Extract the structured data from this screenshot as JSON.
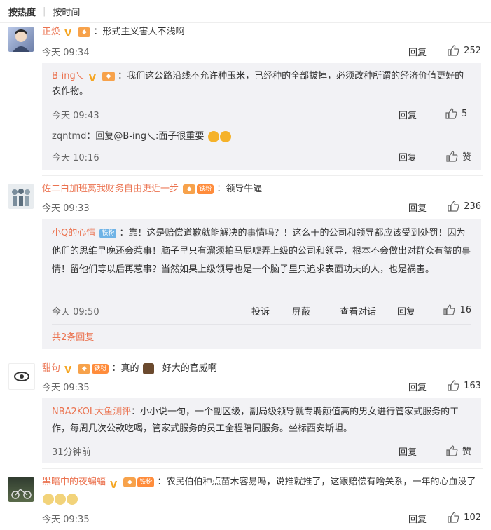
{
  "sort": {
    "hot": "按热度",
    "time": "按时间"
  },
  "labels": {
    "reply": "回复",
    "complain": "投诉",
    "block": "屏蔽",
    "view_dialog": "查看对话",
    "praise": "赞"
  },
  "comments": [
    {
      "user": "正焕",
      "text": "：形式主义害人不浅啊",
      "time": "今天 09:34",
      "likes": "252",
      "replies": [
        {
          "user": "B-ing乀",
          "text": "：我们这公路沿线不允许种玉米，已经种的全部拔掉，必须改种所谓的经济价值更好的农作物。",
          "time": "今天 09:43",
          "likes": "5"
        },
        {
          "user": "zqntmd",
          "text": "：回复@B-ing乀:面子很重要",
          "time": "今天 10:16",
          "likes": "赞"
        }
      ]
    },
    {
      "user": "佐二白加班离我财务自由更近一步",
      "fan": "铁粉",
      "text": "：领导牛逼",
      "time": "今天 09:33",
      "likes": "236",
      "replies": [
        {
          "user": "小Q的心情",
          "fan": "铁粉",
          "text": "：靠！这是赔偿道歉就能解决的事情吗？！这么干的公司和领导都应该受到处罚！因为他们的思维早晚还会惹事！脑子里只有溜须拍马屁唬弄上级的公司和领导，根本不会做出对群众有益的事情！留他们等以后再惹事？当然如果上级领导也是一个脑子里只追求表面功夫的人，也是祸害。",
          "time": "今天 09:50",
          "likes": "16"
        }
      ],
      "more": "共2条回复"
    },
    {
      "user": "甜句",
      "fan": "铁粉",
      "text": "：真的",
      "text2": "好大的官威啊",
      "time": "今天 09:35",
      "likes": "163",
      "replies": [
        {
          "user": "NBA2KOL大鱼测评",
          "text": "：小小说一句，一个副区级，副局级领导就专聘颜值高的男女进行管家式服务的工作，每周几次公款吃喝，管家式服务的员工全程陪同服务。坐标西安斯坦。",
          "time": "31分钟前",
          "likes": "赞"
        }
      ]
    },
    {
      "user": "黑暗中的夜蝙蝠",
      "fan": "铁粉",
      "text": "：农民伯伯种点苗木容易吗，说推就推了，这跟赔偿有啥关系，一年的心血没了",
      "time": "今天 09:35",
      "likes": "102"
    }
  ],
  "icons": {
    "verified": "verified-v-icon",
    "vip": "vip-badge-icon",
    "like": "thumbs-up-icon",
    "emoji_laugh": "laughing-emoji-icon",
    "emoji_sad": "sad-emoji-icon",
    "emoji_bull": "bull-emoji-icon"
  },
  "colors": {
    "username": "#eb7350",
    "reply_bg": "#f2f2f5",
    "badge_orange": "#ff8c3b",
    "badge_blue": "#6fb3e6",
    "vip": "#f7a24b"
  }
}
